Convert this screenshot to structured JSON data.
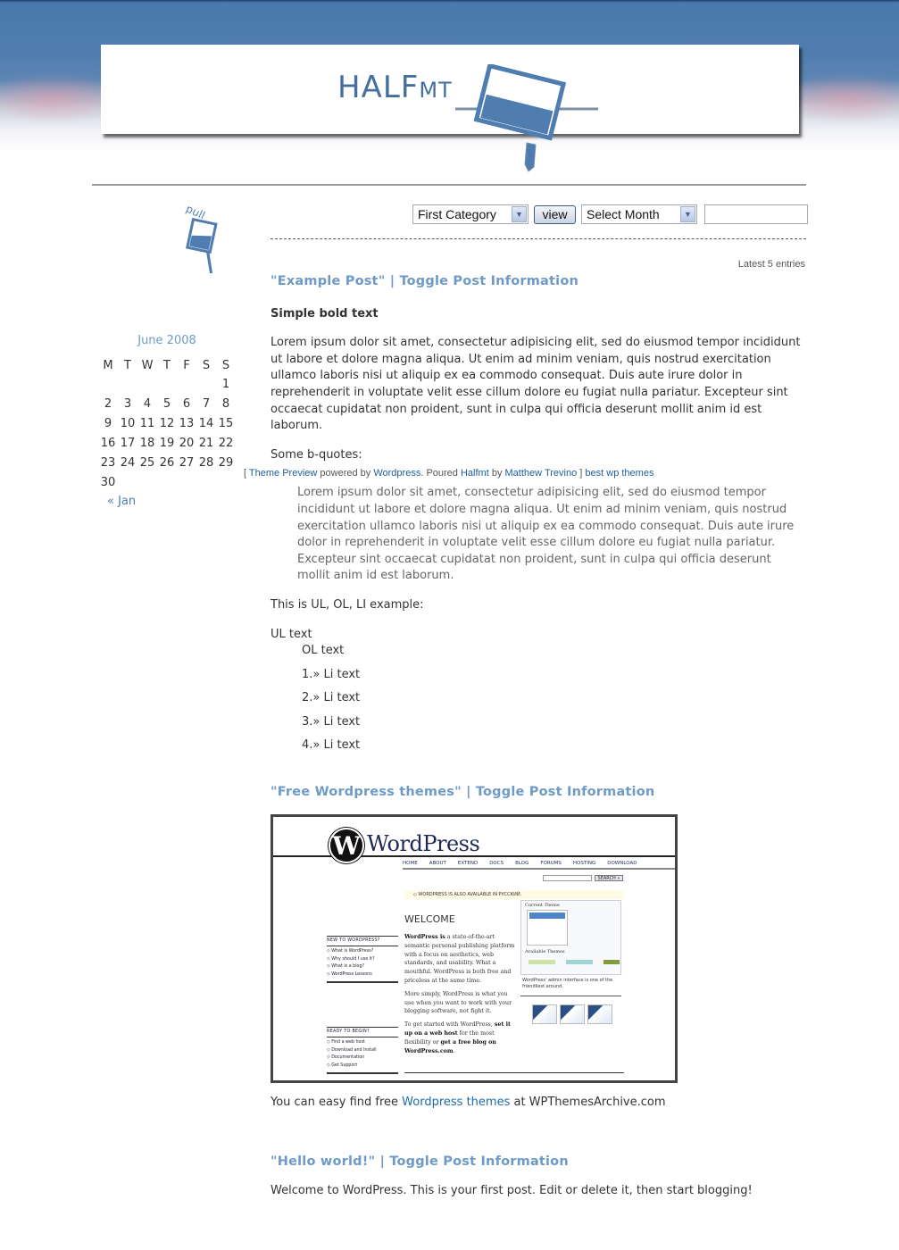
{
  "site": {
    "logo_main": "HALF",
    "logo_small": "MT",
    "sidebar_badge": "pull"
  },
  "controls": {
    "category_select": "First Category",
    "view_button": "view",
    "month_select": "Select Month",
    "search_value": "",
    "latest_label": "Latest 5 entries"
  },
  "calendar": {
    "caption": "June 2008",
    "weekdays": [
      "M",
      "T",
      "W",
      "T",
      "F",
      "S",
      "S"
    ],
    "weeks": [
      [
        "",
        "",
        "",
        "",
        "",
        "",
        "1"
      ],
      [
        "2",
        "3",
        "4",
        "5",
        "6",
        "7",
        "8"
      ],
      [
        "9",
        "10",
        "11",
        "12",
        "13",
        "14",
        "15"
      ],
      [
        "16",
        "17",
        "18",
        "19",
        "20",
        "21",
        "22"
      ],
      [
        "23",
        "24",
        "25",
        "26",
        "27",
        "28",
        "29"
      ],
      [
        "30",
        "",
        "",
        "",
        "",
        "",
        ""
      ]
    ],
    "prev_link": "« Jan"
  },
  "credit": {
    "open": "[",
    "theme_preview": "Theme Preview",
    "powered_by": "powered by",
    "wordpress": "Wordpress",
    "poured": ". Poured",
    "halfmt": "Halfmt",
    "by": "by",
    "author": "Matthew Trevino",
    "close": "]",
    "best": "best wp themes"
  },
  "posts": [
    {
      "title": "\"Example Post\"",
      "separator": "|",
      "toggle": "Toggle Post Information",
      "bold_text": "Simple bold text",
      "paragraph": "Lorem ipsum dolor sit amet, consectetur adipisicing elit, sed do eiusmod tempor incididunt ut labore et dolore magna aliqua. Ut enim ad minim veniam, quis nostrud exercitation ullamco laboris nisi ut aliquip ex ea commodo consequat. Duis aute irure dolor in reprehenderit in voluptate velit esse cillum dolore eu fugiat nulla pariatur. Excepteur sint occaecat cupidatat non proident, sunt in culpa qui officia deserunt mollit anim id est laborum.",
      "bquote_label": "Some b-quotes:",
      "bquote": "Lorem ipsum dolor sit amet, consectetur adipisicing elit, sed do eiusmod tempor incididunt ut labore et dolore magna aliqua. Ut enim ad minim veniam, quis nostrud exercitation ullamco laboris nisi ut aliquip ex ea commodo consequat. Duis aute irure dolor in reprehenderit in voluptate velit esse cillum dolore eu fugiat nulla pariatur. Excepteur sint occaecat cupidatat non proident, sunt in culpa qui officia deserunt mollit anim id est laborum.",
      "list_intro": "This is UL, OL, LI example:",
      "ul_text": "UL text",
      "ol_text": "OL text",
      "li_items": [
        "1.» Li text",
        "2.» Li text",
        "3.» Li text",
        "4.» Li text"
      ]
    },
    {
      "title": "\"Free Wordpress themes\"",
      "separator": "|",
      "toggle": "Toggle Post Information",
      "text_before": "You can easy find free ",
      "link": "Wordpress themes",
      "text_after": " at WPThemesArchive.com"
    },
    {
      "title": "\"Hello world!\"",
      "separator": "|",
      "toggle": "Toggle Post Information",
      "text": "Welcome to WordPress. This is your first post. Edit or delete it, then start blogging!"
    }
  ],
  "wp_screenshot": {
    "logo_letter": "W",
    "logo_text": "WordPress",
    "nav": [
      "HOME",
      "ABOUT",
      "EXTEND",
      "DOCS",
      "BLOG",
      "FORUMS",
      "HOSTING",
      "DOWNLOAD"
    ],
    "search_button": "SEARCH »",
    "notice": "◇ WORDPRESS IS ALSO AVAILABLE IN РУССКИЙ.",
    "welcome": "WELCOME",
    "body1_bold": "WordPress is",
    "body1": " a state-of-the-art semantic personal publishing platform with a focus on aesthetics, web standards, and usability. What a mouthful. WordPress is both free and priceless at the same time.",
    "body2": "More simply, WordPress is what you use when you want to work with your blogging software, not fight it.",
    "body3_a": "To get started with WordPress, ",
    "body3_link1": "set it up on a web host",
    "body3_b": " for the most flexibility or ",
    "body3_link2": "get a free blog on WordPress.com",
    "body3_c": ".",
    "side1_heading": "NEW TO WORDPRESS?",
    "side1_items": [
      "◇ What is WordPress?",
      "◇ Why should I use it?",
      "◇ What is a blog?",
      "◇ WordPress Lessons"
    ],
    "side2_heading": "READY TO BEGIN?",
    "side2_items": [
      "◇ Find a web host",
      "◇ Download and Install",
      "◇ Documentation",
      "◇ Get Support"
    ],
    "current_theme": "Current Theme",
    "available_themes": "Available Themes",
    "caption": "WordPress' admin interface is one of the friendliest around."
  },
  "colors": {
    "accent_blue": "#6e9ac8",
    "link_blue": "#1e6aa8",
    "header_blue": "#4f7db0"
  }
}
